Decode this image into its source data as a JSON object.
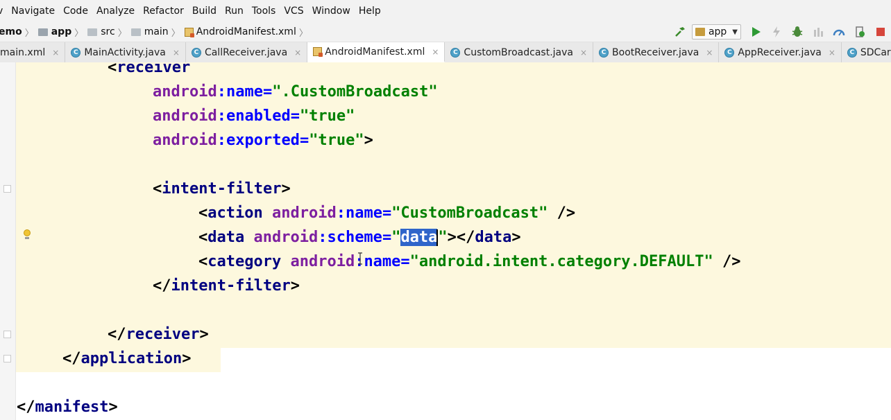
{
  "menu": [
    "v",
    "Navigate",
    "Code",
    "Analyze",
    "Refactor",
    "Build",
    "Run",
    "Tools",
    "VCS",
    "Window",
    "Help"
  ],
  "breadcrumb": {
    "project": "emo",
    "module": "app",
    "folder1": "src",
    "folder2": "main",
    "file": "AndroidManifest.xml"
  },
  "toolbar": {
    "run_config": "app",
    "icons": [
      "build-hammer-icon",
      "run-icon",
      "apply-changes-icon",
      "debug-icon",
      "coverage-icon",
      "profiler-icon",
      "attach-debugger-icon",
      "stop-icon"
    ]
  },
  "tabs": [
    {
      "label": "main.xml",
      "icon": "none",
      "active": false
    },
    {
      "label": "MainActivity.java",
      "icon": "C",
      "active": false
    },
    {
      "label": "CallReceiver.java",
      "icon": "C",
      "active": false
    },
    {
      "label": "AndroidManifest.xml",
      "icon": "xml",
      "active": true
    },
    {
      "label": "CustomBroadcast.java",
      "icon": "C",
      "active": false
    },
    {
      "label": "BootReceiver.java",
      "icon": "C",
      "active": false
    },
    {
      "label": "AppReceiver.java",
      "icon": "C",
      "active": false
    },
    {
      "label": "SDCardRec",
      "icon": "C",
      "active": false
    }
  ],
  "close_glyph": "×",
  "class_icon_letter": "C",
  "code": {
    "l1": {
      "lt": "<",
      "tag": "receiver"
    },
    "l2": {
      "ns": "android",
      "colon": ":",
      "attr": "name",
      "eq": "=",
      "value": "\".CustomBroadcast\""
    },
    "l3": {
      "ns": "android",
      "colon": ":",
      "attr": "enabled",
      "eq": "=",
      "value": "\"true\""
    },
    "l4": {
      "ns": "android",
      "colon": ":",
      "attr": "exported",
      "eq": "=",
      "value": "\"true\"",
      "end": ">"
    },
    "l5": {
      "lt": "<",
      "tag": "intent-filter",
      "gt": ">"
    },
    "l6": {
      "lt": "<",
      "tag": "action",
      "ns": "android",
      "colon": ":",
      "attr": "name",
      "eq": "=",
      "value": "\"CustomBroadcast\"",
      "end": " />"
    },
    "l7": {
      "lt": "<",
      "tag": "data",
      "ns": "android",
      "colon": ":",
      "attr": "scheme",
      "eq": "=",
      "q1": "\"",
      "selected": "data",
      "q2": "\"",
      "mid": "></",
      "tag2": "data",
      "gt": ">"
    },
    "l8": {
      "lt": "<",
      "tag": "category",
      "ns": "android",
      "colon": ":",
      "attr": "name",
      "eq": "=",
      "value": "\"android.intent.category.DEFAULT\"",
      "end": " />"
    },
    "l9": {
      "lt": "</",
      "tag": "intent-filter",
      "gt": ">"
    },
    "l10": {
      "lt": "</",
      "tag": "receiver",
      "gt": ">"
    },
    "l11": {
      "lt": "</",
      "tag": "application",
      "gt": ">"
    },
    "l12": {
      "lt": "</",
      "tag": "manifest",
      "gt": ">"
    }
  },
  "colors": {
    "tag": "#000080",
    "namespace": "#7d1fa0",
    "attribute": "#0000ff",
    "value": "#008000",
    "highlight_bg": "#fdf8de",
    "selection": "#2f65ca"
  }
}
